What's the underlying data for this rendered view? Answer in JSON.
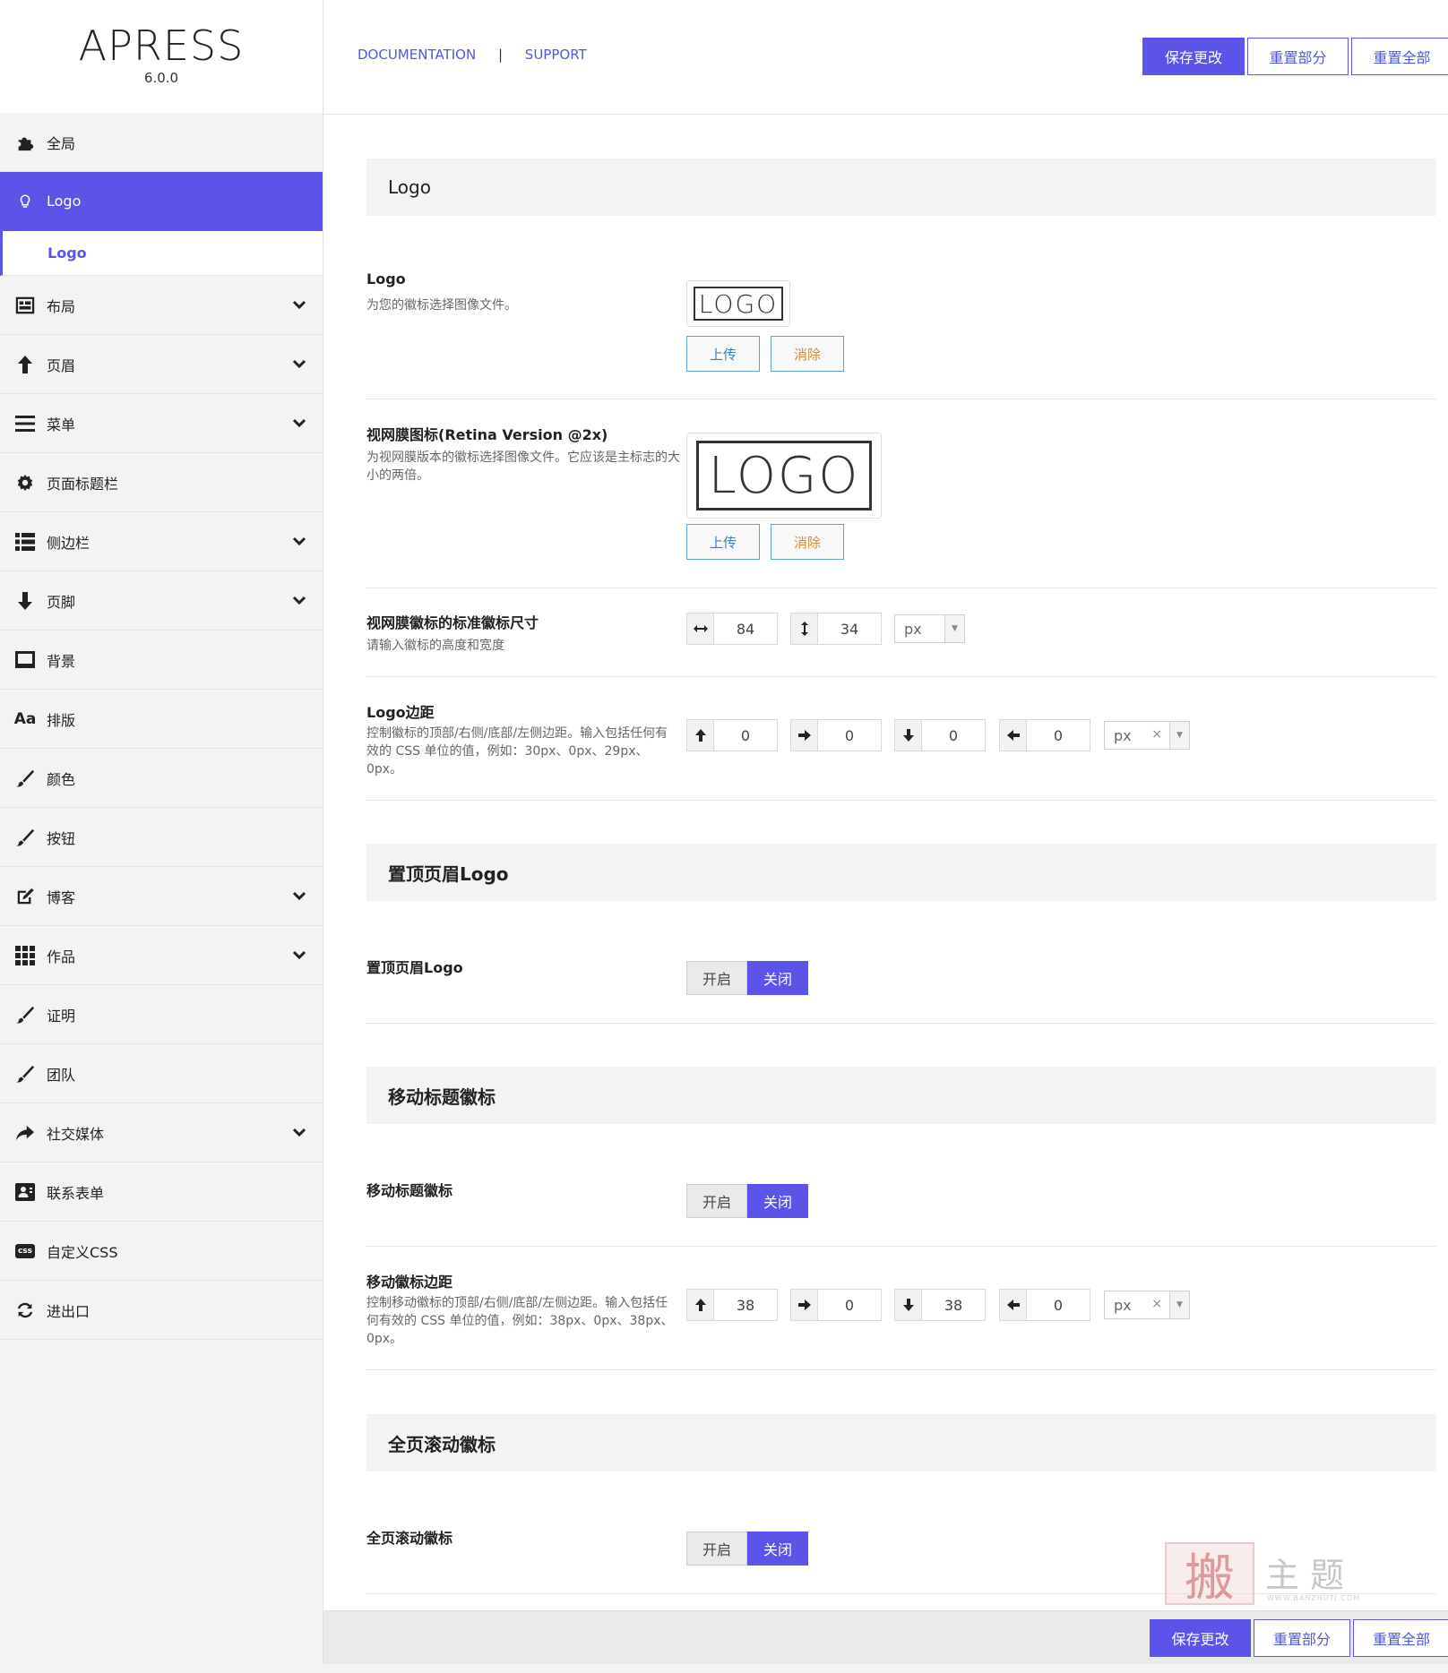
{
  "brand": {
    "name": "APRESS",
    "version": "6.0.0"
  },
  "header": {
    "links": [
      "DOCUMENTATION",
      "SUPPORT"
    ],
    "separator": "|",
    "save": "保存更改",
    "reset_section": "重置部分",
    "reset_all": "重置全部"
  },
  "sidebar": {
    "items": [
      {
        "label": "全局",
        "icon": "puzzle-icon",
        "expandable": false
      },
      {
        "label": "Logo",
        "icon": "lightbulb-icon",
        "expandable": false,
        "active": true
      },
      {
        "label": "布局",
        "icon": "layout-icon",
        "expandable": true
      },
      {
        "label": "页眉",
        "icon": "arrow-up-icon",
        "expandable": true
      },
      {
        "label": "菜单",
        "icon": "menu-icon",
        "expandable": true
      },
      {
        "label": "页面标题栏",
        "icon": "gear-icon",
        "expandable": false
      },
      {
        "label": "侧边栏",
        "icon": "list-icon",
        "expandable": true
      },
      {
        "label": "页脚",
        "icon": "arrow-down-icon",
        "expandable": true
      },
      {
        "label": "背景",
        "icon": "monitor-icon",
        "expandable": false
      },
      {
        "label": "排版",
        "icon": "font-icon",
        "expandable": false
      },
      {
        "label": "颜色",
        "icon": "brush-icon",
        "expandable": false
      },
      {
        "label": "按钮",
        "icon": "brush-icon",
        "expandable": false
      },
      {
        "label": "博客",
        "icon": "edit-icon",
        "expandable": true
      },
      {
        "label": "作品",
        "icon": "grid-icon",
        "expandable": true
      },
      {
        "label": "证明",
        "icon": "brush-icon",
        "expandable": false
      },
      {
        "label": "团队",
        "icon": "brush-icon",
        "expandable": false
      },
      {
        "label": "社交媒体",
        "icon": "share-icon",
        "expandable": true
      },
      {
        "label": "联系表单",
        "icon": "contact-card-icon",
        "expandable": false
      },
      {
        "label": "自定义CSS",
        "icon": "css-icon",
        "expandable": false
      },
      {
        "label": "进出口",
        "icon": "refresh-icon",
        "expandable": false
      }
    ],
    "sub_item": "Logo",
    "font_icon_text": "Aa",
    "css_icon_text": "css"
  },
  "sections": {
    "logo": {
      "title": "Logo",
      "logo_field": {
        "title": "Logo",
        "desc": "为您的徽标选择图像文件。",
        "preview": "LOGO",
        "upload": "上传",
        "remove": "消除"
      },
      "retina_field": {
        "title": "视网膜图标(Retina Version @2x)",
        "desc": "为视网膜版本的徽标选择图像文件。它应该是主标志的大小的两倍。",
        "preview": "LOGO",
        "upload": "上传",
        "remove": "消除"
      },
      "dimensions_field": {
        "title": "视网膜徽标的标准徽标尺寸",
        "desc": "请输入徽标的高度和宽度",
        "width": "84",
        "height": "34",
        "unit": "px"
      },
      "margin_field": {
        "title": "Logo边距",
        "desc": "控制徽标的顶部/右侧/底部/左侧边距。输入包括任何有效的 CSS 单位的值，例如：30px、0px、29px、0px。",
        "top": "0",
        "right": "0",
        "bottom": "0",
        "left": "0",
        "unit": "px",
        "clear": "×"
      }
    },
    "sticky": {
      "title": "置顶页眉Logo",
      "field": {
        "title": "置顶页眉Logo",
        "on": "开启",
        "off": "关闭"
      }
    },
    "mobile": {
      "title": "移动标题徽标",
      "field": {
        "title": "移动标题徽标",
        "on": "开启",
        "off": "关闭"
      },
      "margin_field": {
        "title": "移动徽标边距",
        "desc": "控制移动徽标的顶部/右侧/底部/左侧边距。输入包括任何有效的 CSS 单位的值，例如：38px、0px、38px、0px。",
        "top": "38",
        "right": "0",
        "bottom": "38",
        "left": "0",
        "unit": "px",
        "clear": "×"
      }
    },
    "fullpage": {
      "title": "全页滚动徽标",
      "field": {
        "title": "全页滚动徽标",
        "on": "开启",
        "off": "关闭"
      }
    }
  },
  "footer": {
    "save": "保存更改",
    "reset_section": "重置部分",
    "reset_all": "重置全部"
  },
  "watermark": {
    "mark": "搬",
    "text": "主题",
    "url": "WWW.BANZHUTI.COM"
  },
  "colors": {
    "accent": "#5c53e8",
    "link": "#4a5ad8",
    "sidebar_bg": "#f3f3f3"
  }
}
